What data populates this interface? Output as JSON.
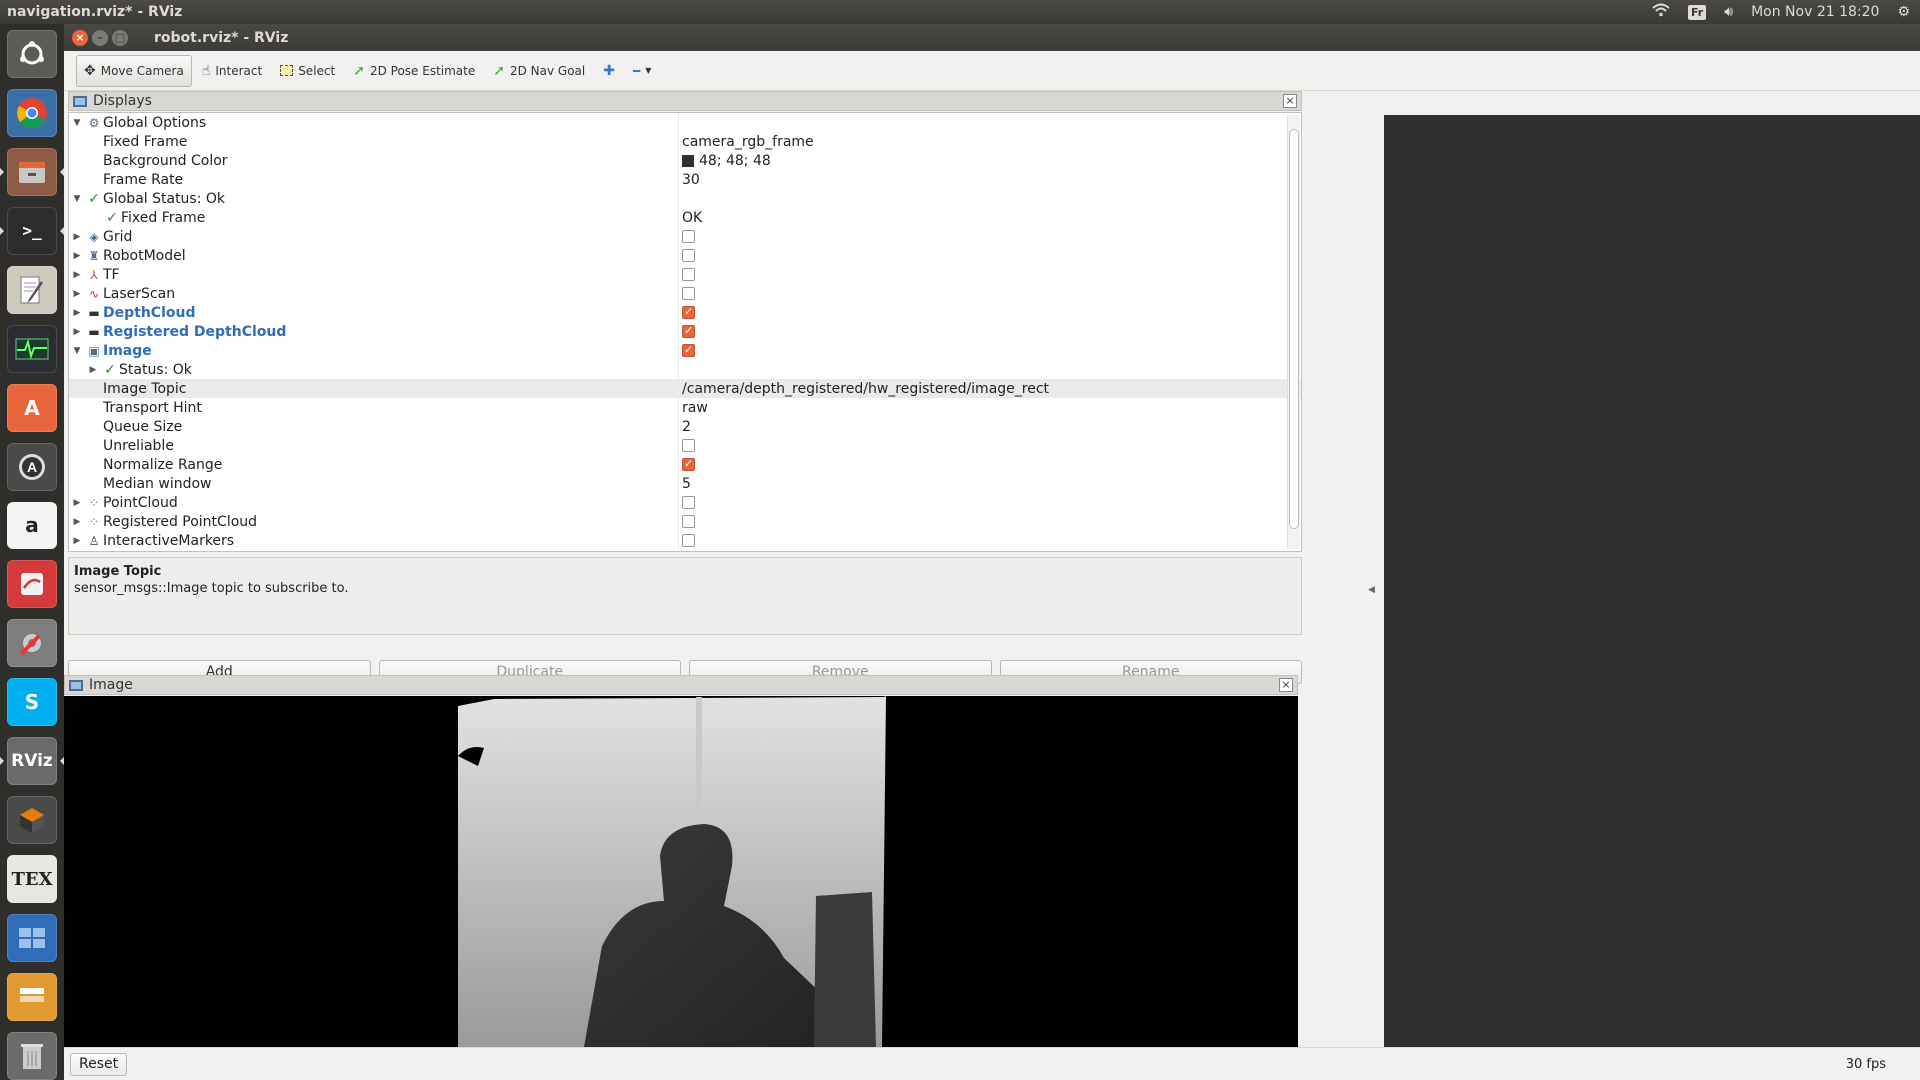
{
  "system": {
    "window_title": "navigation.rviz* - RViz",
    "keyboard_layout": "Fr",
    "datetime": "Mon Nov 21 18:20"
  },
  "app": {
    "title": "robot.rviz* - RViz"
  },
  "toolbar": {
    "tools": [
      {
        "label": "Move Camera",
        "icon": "move-camera-icon"
      },
      {
        "label": "Interact",
        "icon": "hand-icon"
      },
      {
        "label": "Select",
        "icon": "select-icon"
      },
      {
        "label": "2D Pose Estimate",
        "icon": "pose-arrow-icon"
      },
      {
        "label": "2D Nav Goal",
        "icon": "goal-arrow-icon"
      }
    ]
  },
  "displays_panel": {
    "title": "Displays",
    "rows": [
      {
        "label": "Global Options",
        "value": ""
      },
      {
        "label": "Fixed Frame",
        "value": "camera_rgb_frame"
      },
      {
        "label": "Background Color",
        "value": "48; 48; 48"
      },
      {
        "label": "Frame Rate",
        "value": "30"
      },
      {
        "label": "Global Status: Ok",
        "value": ""
      },
      {
        "label": "Fixed Frame",
        "value": "OK"
      },
      {
        "label": "Grid",
        "checked": false
      },
      {
        "label": "RobotModel",
        "checked": false
      },
      {
        "label": "TF",
        "checked": false
      },
      {
        "label": "LaserScan",
        "checked": false
      },
      {
        "label": "DepthCloud",
        "checked": true
      },
      {
        "label": "Registered DepthCloud",
        "checked": true
      },
      {
        "label": "Image",
        "checked": true
      },
      {
        "label": "Status: Ok",
        "value": ""
      },
      {
        "label": "Image Topic",
        "value": "/camera/depth_registered/hw_registered/image_rect"
      },
      {
        "label": "Transport Hint",
        "value": "raw"
      },
      {
        "label": "Queue Size",
        "value": "2"
      },
      {
        "label": "Unreliable",
        "checked": false
      },
      {
        "label": "Normalize Range",
        "checked": true
      },
      {
        "label": "Median window",
        "value": "5"
      },
      {
        "label": "PointCloud",
        "checked": false
      },
      {
        "label": "Registered PointCloud",
        "checked": false
      },
      {
        "label": "InteractiveMarkers",
        "checked": false
      }
    ],
    "description_title": "Image Topic",
    "description_text": "sensor_msgs::Image topic to subscribe to.",
    "buttons": {
      "add": "Add",
      "duplicate": "Duplicate",
      "remove": "Remove",
      "rename": "Rename"
    }
  },
  "image_panel": {
    "title": "Image"
  },
  "statusbar": {
    "reset": "Reset",
    "fps": "30 fps"
  },
  "colors": {
    "background_3d": "#303030",
    "accent_checkbox": "#e9663c",
    "link_blue": "#2f6db8"
  }
}
